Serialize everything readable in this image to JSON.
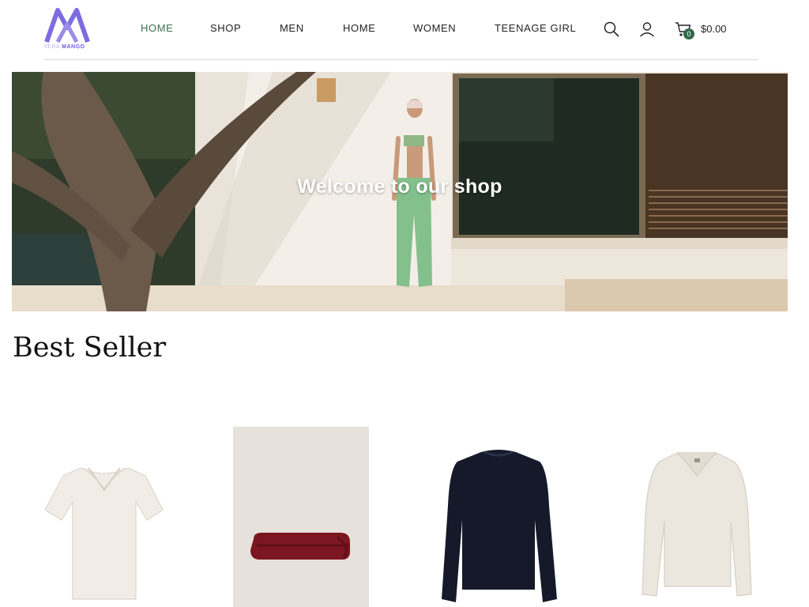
{
  "brand": {
    "prefix": "YERA",
    "name": "MANGO",
    "accent_color": "#7d6ce0"
  },
  "nav": {
    "items": [
      {
        "label": "HOME",
        "active": true
      },
      {
        "label": "SHOP"
      },
      {
        "label": "MEN"
      },
      {
        "label": "HOME"
      },
      {
        "label": "WOMEN"
      },
      {
        "label": "TEENAGE GIRL"
      }
    ],
    "active_color": "#3c6e57"
  },
  "header_actions": {
    "search_icon": "search-icon",
    "account_icon": "user-icon",
    "cart_icon": "cart-icon",
    "cart_count": "0",
    "cart_total": "$0.00",
    "badge_color": "#2f6a4a"
  },
  "hero": {
    "title": "Welcome to our shop"
  },
  "best_seller": {
    "title": "Best Seller",
    "products": [
      {
        "image": "white-knit-polo-shirt"
      },
      {
        "image": "folded-burgundy-blanket"
      },
      {
        "image": "navy-crew-neck-sweater"
      },
      {
        "image": "cream-polo-collar-sweater"
      }
    ]
  }
}
